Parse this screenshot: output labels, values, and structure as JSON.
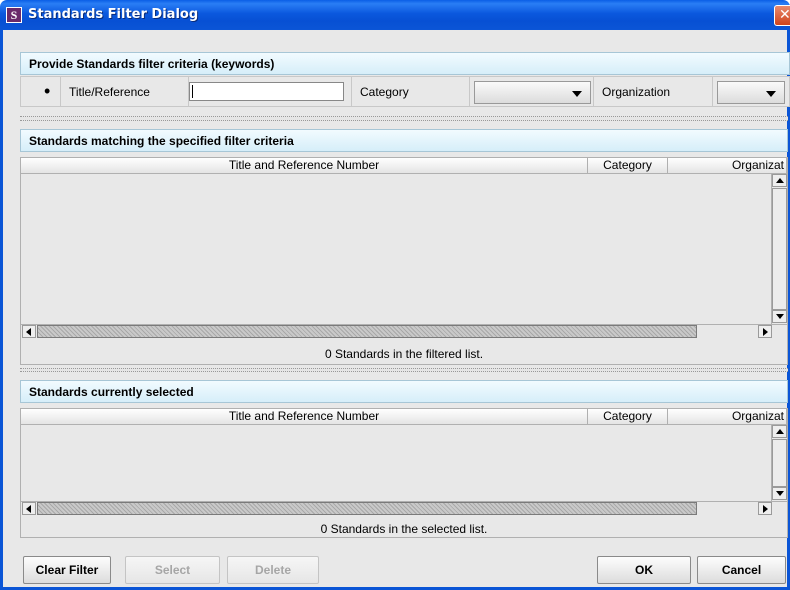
{
  "window": {
    "title": "Standards Filter Dialog",
    "icon_letter": "S",
    "close_glyph": "✕"
  },
  "filter": {
    "header": "Provide Standards filter criteria (keywords)",
    "bullet": "•",
    "title_label": "Title/Reference",
    "title_value": "",
    "category_label": "Category",
    "category_value": "",
    "organization_label": "Organization",
    "organization_value": ""
  },
  "matching": {
    "header": "Standards matching the specified filter criteria",
    "columns": [
      "Title and Reference Number",
      "Category",
      "Organizat"
    ],
    "rows": [],
    "status": "0 Standards in the filtered list."
  },
  "selected": {
    "header": "Standards currently selected",
    "columns": [
      "Title and Reference Number",
      "Category",
      "Organizat"
    ],
    "rows": [],
    "status": "0 Standards in the selected list."
  },
  "buttons": {
    "clear_filter": "Clear Filter",
    "select": "Select",
    "delete": "Delete",
    "ok": "OK",
    "cancel": "Cancel"
  },
  "colors": {
    "titlebar": "#0b58de",
    "section_header": "#d6eef9",
    "panel": "#e8e8e8",
    "close": "#d0431c"
  }
}
